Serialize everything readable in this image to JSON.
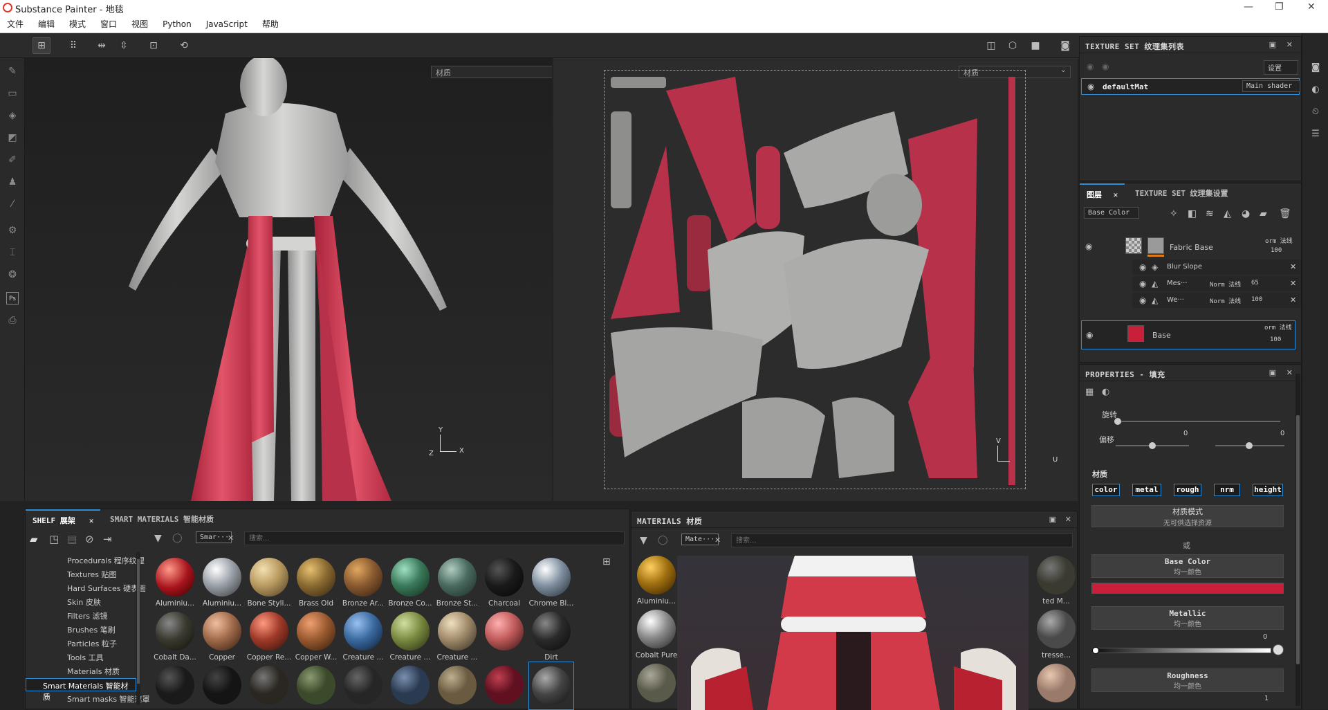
{
  "window": {
    "title": "Substance Painter - 地毯"
  },
  "menu": [
    "文件",
    "编辑",
    "模式",
    "窗口",
    "视图",
    "Python",
    "JavaScript",
    "帮助"
  ],
  "viewport3d": {
    "mode_select": "材质",
    "axis_y": "Y",
    "axis_x": "X",
    "axis_z": "Z"
  },
  "viewport2d": {
    "mode_select": "材质",
    "axis_v": "V",
    "axis_u": "U"
  },
  "texture_set_list": {
    "title": "TEXTURE SET 纹理集列表",
    "settings_label": "设置",
    "material": "defaultMat",
    "shader": "Main shader"
  },
  "layers": {
    "tab_layers": "图层",
    "tab_settings": "TEXTURE SET 纹理集设置",
    "channel": "Base Color",
    "items": [
      {
        "name": "Fabric Base",
        "blend": "orm 法线",
        "opacity": "100"
      },
      {
        "name": "Blur Slope"
      },
      {
        "name": "Mes···",
        "blend": "Norm 法线",
        "opacity": "65"
      },
      {
        "name": "We···",
        "blend": "Norm 法线",
        "opacity": "100"
      },
      {
        "name": "Base",
        "blend": "orm 法线",
        "opacity": "100"
      }
    ]
  },
  "properties": {
    "title": "PROPERTIES - 填充",
    "rotate_label": "旋转",
    "offset_label": "偏移",
    "offset_x": "0",
    "offset_y": "0",
    "material_label": "材质",
    "channels": [
      "color",
      "metal",
      "rough",
      "nrm",
      "height"
    ],
    "material_mode": "材质模式",
    "material_mode_sub": "无可供选择资源",
    "or": "或",
    "base_color": "Base Color",
    "base_color_sub": "均一颜色",
    "base_color_hex": "#c8203a",
    "metallic": "Metallic",
    "metallic_sub": "均一颜色",
    "metallic_value": "0",
    "roughness": "Roughness",
    "roughness_sub": "均一颜色",
    "roughness_value": "1"
  },
  "shelf": {
    "tab_shelf": "SHELF 展架",
    "tab_smart": "SMART MATERIALS 智能材质",
    "filter_chip": "Smar···",
    "search_placeholder": "搜索...",
    "categories": [
      "Procedurals 程序纹理",
      "Textures 贴图",
      "Hard Surfaces 硬表面",
      "Skin 皮肤",
      "Filters 滤镜",
      "Brushes 笔刷",
      "Particles 粒子",
      "Tools 工具",
      "Materials 材质",
      "Smart Materials 智能材质",
      "Smart masks 智能遮罩"
    ],
    "selected_category": "Smart Materials 智能材质",
    "row1": [
      "Aluminiu...",
      "Aluminiu...",
      "Bone Styli...",
      "Brass Old",
      "Bronze Ar...",
      "Bronze Co...",
      "Bronze St...",
      "Charcoal",
      "Chrome Bl..."
    ],
    "row2": [
      "Cobalt Da...",
      "Copper",
      "Copper Re...",
      "Copper W...",
      "Creature ...",
      "Creature ...",
      "Creature ...",
      "Dirt"
    ]
  },
  "materials": {
    "title": "MATERIALS 材质",
    "filter_chip": "Mate···",
    "search_placeholder": "搜索...",
    "items": [
      "Aluminiu...",
      "Cobalt Pure"
    ],
    "right_items": [
      "ted M...",
      "tresse..."
    ]
  }
}
